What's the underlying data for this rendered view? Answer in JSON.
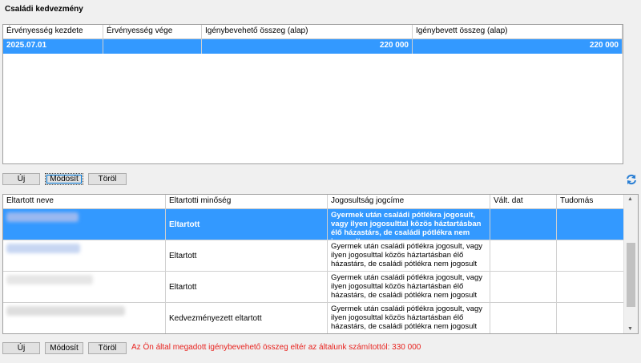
{
  "title": "Családi kedvezmény",
  "upper_grid": {
    "headers": [
      "Érvényesség kezdete",
      "Érvényesség vége",
      "Igénybevehető összeg (alap)",
      "Igénybevett összeg (alap)"
    ],
    "row": {
      "start": "2025.07.01",
      "end": "",
      "eligible": "220 000",
      "claimed": "220 000"
    }
  },
  "buttons_top": {
    "new": "Új",
    "modify": "Módosít",
    "delete": "Töröl"
  },
  "lower_grid": {
    "headers": [
      "Eltartott neve",
      "Eltartotti minőség",
      "Jogosultság jogcíme",
      "Vált. dat",
      "Tudomás"
    ],
    "rows": [
      {
        "quality": "Eltartott",
        "basis": "Gyermek után családi pótlékra jogosult, vagy ilyen jogosulttal közös háztartásban élő házastárs, de családi pótlékra nem jogosult",
        "blur_color": "#9ab8f0"
      },
      {
        "quality": "Eltartott",
        "basis": "Gyermek után családi pótlékra jogosult, vagy ilyen jogosulttal közös háztartásban élő házastárs, de családi pótlékra nem jogosult",
        "blur_color": "#c7d6f2"
      },
      {
        "quality": "Eltartott",
        "basis": "Gyermek után családi pótlékra jogosult, vagy ilyen jogosulttal közös háztartásban élő házastárs, de családi pótlékra nem jogosult",
        "blur_color": "#e6e6e6"
      },
      {
        "quality": "Kedvezményezett eltartott",
        "basis": "Gyermek után családi pótlékra jogosult, vagy ilyen jogosulttal közös háztartásban élő házastárs, de családi pótlékra nem jogosult",
        "blur_color": "#dedede"
      }
    ]
  },
  "buttons_bottom": {
    "new": "Új",
    "modify": "Módosít",
    "delete": "Töröl"
  },
  "warning": "Az Ön által megadott igénybevehető összeg eltér az általunk számítottól: 330 000",
  "colors": {
    "selection": "#3399ff",
    "warning": "#e8231f"
  }
}
